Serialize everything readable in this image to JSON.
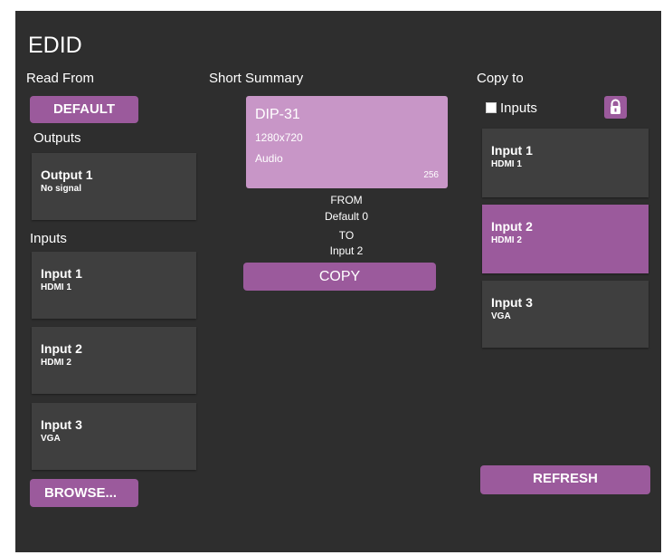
{
  "title": "EDID",
  "read_from": {
    "heading": "Read From",
    "default_button": "DEFAULT",
    "outputs_heading": "Outputs",
    "outputs": [
      {
        "name": "Output 1",
        "sub": "No signal"
      }
    ],
    "inputs_heading": "Inputs",
    "inputs": [
      {
        "name": "Input 1",
        "sub": "HDMI 1"
      },
      {
        "name": "Input 2",
        "sub": "HDMI 2"
      },
      {
        "name": "Input 3",
        "sub": "VGA"
      }
    ],
    "browse_button": "BROWSE..."
  },
  "summary": {
    "heading": "Short Summary",
    "name": "DIP-31",
    "resolution": "1280x720",
    "audio": "Audio",
    "size": "256",
    "from_label": "FROM",
    "from_value": "Default 0",
    "to_label": "TO",
    "to_value": "Input 2",
    "copy_button": "COPY"
  },
  "copy_to": {
    "heading": "Copy to",
    "inputs_checkbox_label": "Inputs",
    "inputs_checked": false,
    "lock_icon": "lock-icon",
    "inputs": [
      {
        "name": "Input 1",
        "sub": "HDMI 1",
        "selected": false
      },
      {
        "name": "Input 2",
        "sub": "HDMI 2",
        "selected": true
      },
      {
        "name": "Input 3",
        "sub": "VGA",
        "selected": false
      }
    ],
    "refresh_button": "REFRESH"
  },
  "colors": {
    "background": "#2e2e2e",
    "card": "#3f3f3f",
    "accent": "#9b5a9c",
    "summary_card": "#c896c7"
  }
}
